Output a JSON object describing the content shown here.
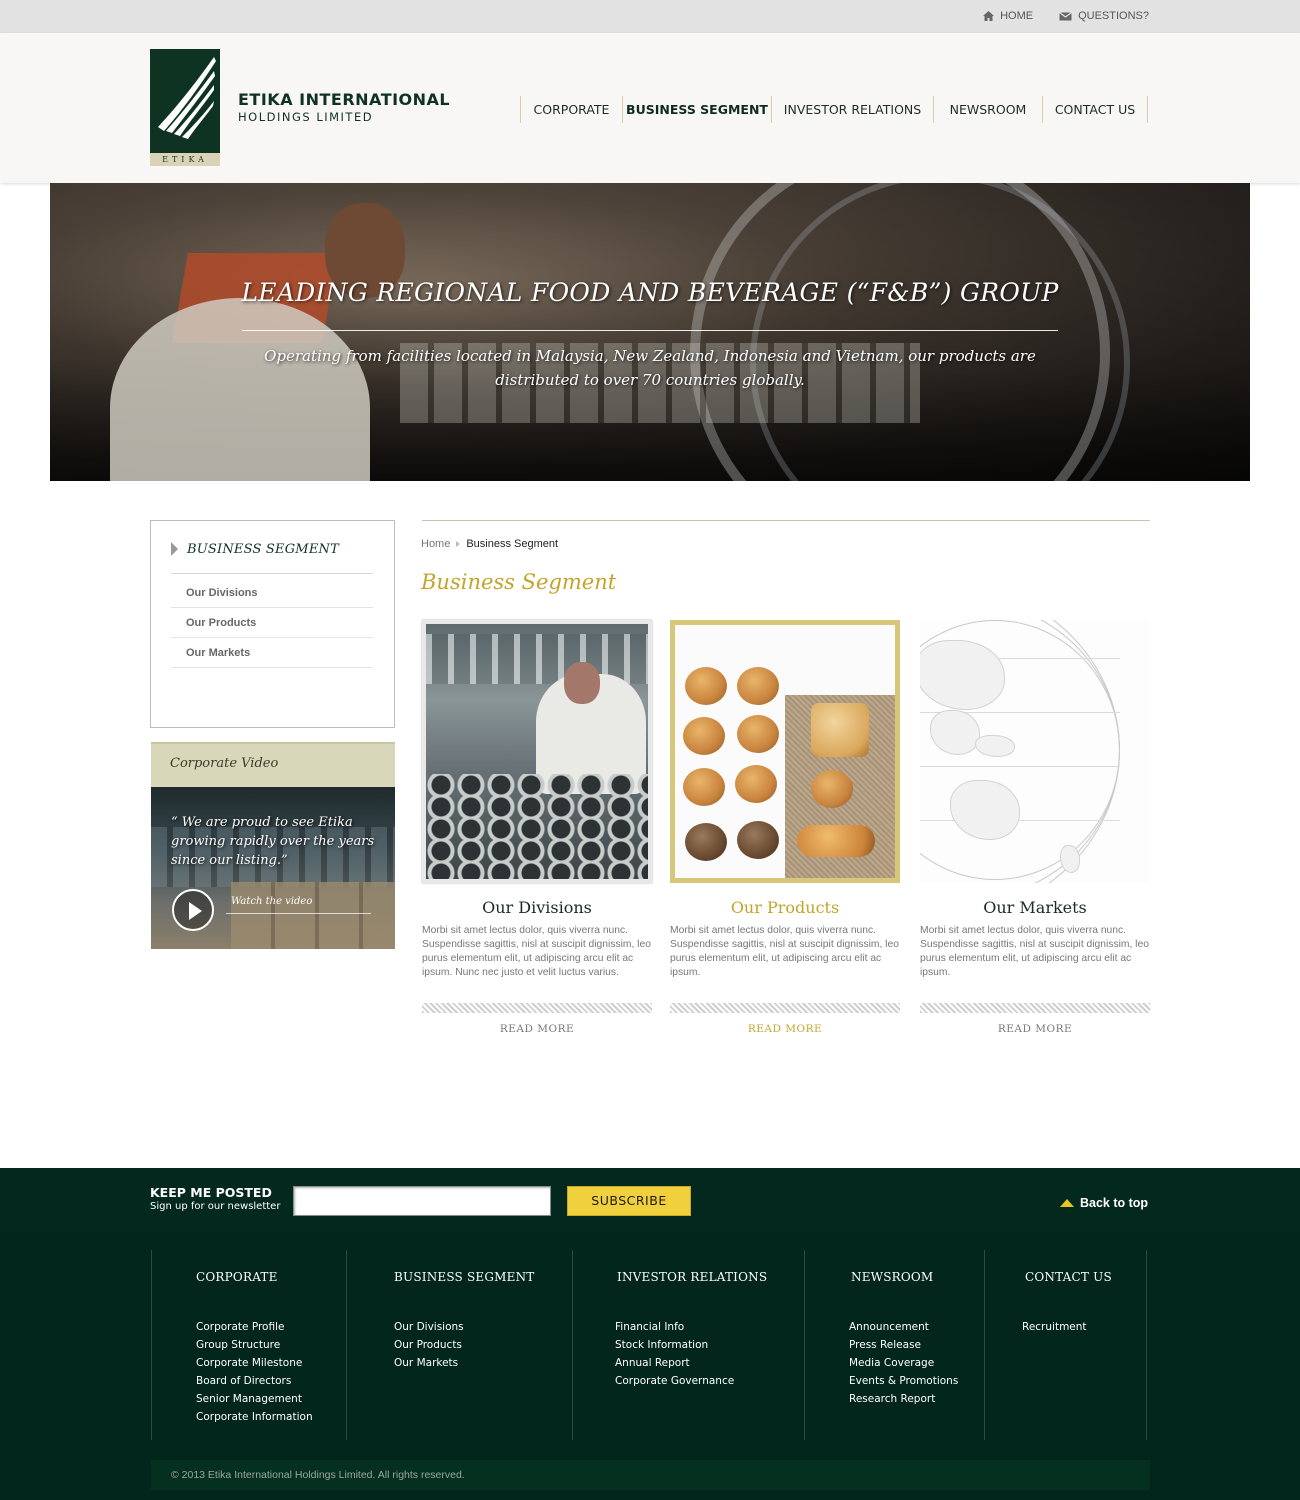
{
  "topbar": {
    "home_label": "HOME",
    "questions_label": "QUESTIONS?"
  },
  "header": {
    "logo_strip_text": "ETIKA",
    "brand_name": "ETIKA INTERNATIONAL",
    "brand_sub": "HOLDINGS LIMITED",
    "nav": [
      {
        "label": "CORPORATE"
      },
      {
        "label": "BUSINESS SEGMENT"
      },
      {
        "label": "INVESTOR RELATIONS"
      },
      {
        "label": "NEWSROOM"
      },
      {
        "label": "CONTACT US"
      }
    ],
    "active_nav": "BUSINESS SEGMENT"
  },
  "hero": {
    "title": "LEADING REGIONAL FOOD AND BEVERAGE (“F&B”) GROUP",
    "description": "Operating from facilities located in Malaysia, New Zealand, Indonesia and Vietnam, our products are distributed to over 70 countries globally."
  },
  "sidebar": {
    "title": "BUSINESS SEGMENT",
    "items": [
      {
        "label": "Our Divisions"
      },
      {
        "label": "Our Products"
      },
      {
        "label": "Our Markets"
      }
    ],
    "video": {
      "heading": "Corporate Video",
      "quote": "“ We are proud to see Etika growing rapidly over the years since our listing.”",
      "watch_label": "Watch the video"
    }
  },
  "breadcrumb": {
    "home": "Home",
    "current": "Business Segment"
  },
  "main": {
    "title": "Business Segment",
    "cards": [
      {
        "title": "Our Divisions",
        "text": "Morbi sit amet lectus dolor, quis viverra nunc. Suspendisse sagittis, nisl at suscipit dignissim, leo purus elementum elit, ut adipiscing arcu elit ac ipsum. Nunc nec justo et velit luctus varius.",
        "more": "READ MORE"
      },
      {
        "title": "Our Products",
        "text": "Morbi sit amet lectus dolor, quis viverra nunc. Suspendisse sagittis, nisl at suscipit dignissim, leo purus elementum elit, ut adipiscing arcu elit ac ipsum.",
        "more": "READ MORE"
      },
      {
        "title": "Our Markets",
        "text": "Morbi sit amet lectus dolor, quis viverra nunc. Suspendisse sagittis, nisl at suscipit dignissim, leo purus elementum elit, ut adipiscing arcu elit ac ipsum.",
        "more": "READ MORE"
      }
    ]
  },
  "newsletter": {
    "title": "KEEP ME POSTED",
    "subtitle": "Sign up for our newsletter",
    "input_value": "",
    "button_label": "SUBSCRIBE",
    "back_to_top": "Back to top"
  },
  "footer": {
    "columns": [
      {
        "heading": "CORPORATE",
        "links": [
          "Corporate Profile",
          "Group Structure",
          "Corporate Milestone",
          "Board of Directors",
          "Senior Management",
          "Corporate Information"
        ]
      },
      {
        "heading": "BUSINESS SEGMENT",
        "links": [
          "Our Divisions",
          "Our Products",
          "Our Markets"
        ]
      },
      {
        "heading": "INVESTOR RELATIONS",
        "links": [
          "Financial Info",
          "Stock Information",
          "Annual Report",
          "Corporate Governance"
        ]
      },
      {
        "heading": "NEWSROOM",
        "links": [
          "Announcement",
          "Press Release",
          "Media Coverage",
          "Events & Promotions",
          "Research Report"
        ]
      },
      {
        "heading": "CONTACT US",
        "links": [
          "Recruitment"
        ]
      }
    ],
    "copyright": "© 2013 Etika International Holdings Limited. All rights reserved."
  },
  "colors": {
    "brand_green": "#0f3323",
    "accent_gold": "#c3a42b",
    "subscribe_yellow": "#f0d03c",
    "footer_bg": "#02261b"
  }
}
